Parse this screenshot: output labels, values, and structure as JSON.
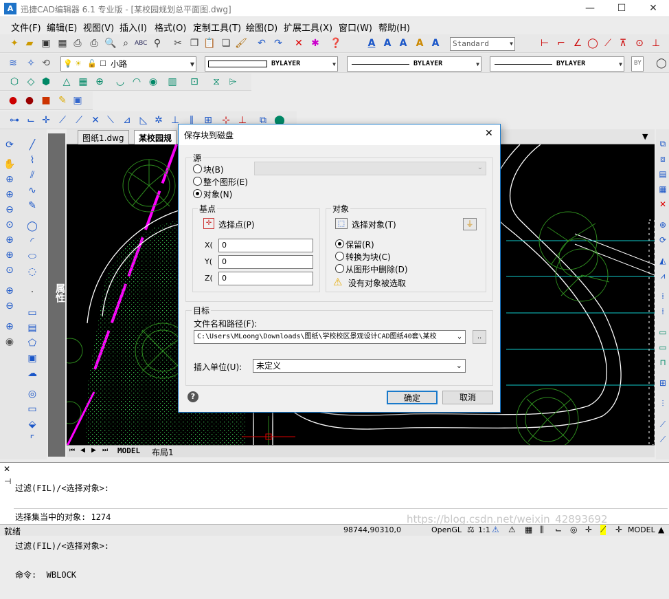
{
  "window": {
    "title": "迅捷CAD编辑器 6.1 专业版  - [某校园规划总平面图.dwg]",
    "app_icon": "A",
    "controls": {
      "minimize": "—",
      "maximize": "☐",
      "close": "✕"
    }
  },
  "menu": [
    "文件(F)",
    "编辑(E)",
    "视图(V)",
    "插入(I)",
    "格式(O)",
    "定制工具(T)",
    "绘图(D)",
    "扩展工具(X)",
    "窗口(W)",
    "帮助(H)"
  ],
  "toolbar": {
    "text_style": "Standard",
    "layer": "小路",
    "color": "BYLAYER",
    "linetype": "BYLAYER",
    "lineweight": "BYLAYER",
    "plot_style": "BY"
  },
  "doc_tabs": [
    "图纸1.dwg",
    "某校园规"
  ],
  "side_panel": {
    "label": "属性"
  },
  "layout_tabs": [
    "MODEL",
    "布局1"
  ],
  "layout_nav": [
    "⏮",
    "◀",
    "▶",
    "⏭"
  ],
  "command_lines": [
    "过滤(FIL)/<选择对象>:",
    "选择集当中的对象: 1274",
    "过滤(FIL)/<选择对象>:",
    "命令:  WBLOCK"
  ],
  "watermark": "https://blog.csdn.net/weixin_42893692",
  "status": {
    "ready": "就绪",
    "coords": "98744,90310,0",
    "opengl": "OpenGL",
    "scale": "1:1",
    "model": "MODEL"
  },
  "dialog": {
    "title": "保存块到磁盘",
    "close": "✕",
    "source": {
      "label": "源",
      "options": [
        "块(B)",
        "整个图形(E)",
        "对象(N)"
      ],
      "selected_index": 2
    },
    "base_point": {
      "label": "基点",
      "pick_label": "选择点(P)",
      "x_label": "X(",
      "y_label": "Y(",
      "z_label": "Z(",
      "x": "0",
      "y": "0",
      "z": "0"
    },
    "objects": {
      "label": "对象",
      "select_label": "选择对象(T)",
      "options": [
        "保留(R)",
        "转换为块(C)",
        "从图形中删除(D)"
      ],
      "selected_index": 0,
      "warning": "没有对象被选取"
    },
    "target": {
      "label": "目标",
      "path_label": "文件名和路径(F):",
      "path": "C:\\Users\\MLoong\\Downloads\\图纸\\学校校区景观设计CAD图纸40套\\某校",
      "browse": "..",
      "unit_label": "插入单位(U):",
      "unit": "未定义"
    },
    "ok": "确定",
    "cancel": "取消"
  },
  "colors": {
    "accent": "#1979ca",
    "magenta_line": "#ff00ff",
    "tree_green": "#2e8b1e",
    "canvas": "#000000"
  }
}
